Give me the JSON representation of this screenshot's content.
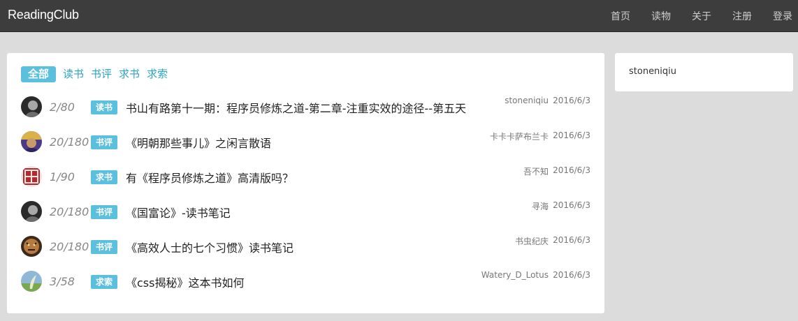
{
  "navbar": {
    "brand": "ReadingClub",
    "links": [
      "首页",
      "读物",
      "关于",
      "注册",
      "登录"
    ]
  },
  "tabs": [
    "全部",
    "读书",
    "书评",
    "求书",
    "求索"
  ],
  "topics": [
    {
      "count": "2/80",
      "badge": "读书",
      "title": "书山有路第十一期：程序员修炼之道-第二章-注重实效的途径--第五天",
      "author": "stoneniqiu",
      "date": "2016/6/3"
    },
    {
      "count": "20/180",
      "badge": "书评",
      "title": "《明朝那些事儿》之闲言散语",
      "author": "卡卡卡萨布兰卡",
      "date": "2016/6/3"
    },
    {
      "count": "1/90",
      "badge": "求书",
      "title": "有《程序员修炼之道》高清版吗？",
      "author": "吾不知",
      "date": "2016/6/3"
    },
    {
      "count": "20/180",
      "badge": "书评",
      "title": "《国富论》-读书笔记",
      "author": "寻海",
      "date": "2016/6/3"
    },
    {
      "count": "20/180",
      "badge": "书评",
      "title": "《高效人士的七个习惯》读书笔记",
      "author": "书虫纪庆",
      "date": "2016/6/3"
    },
    {
      "count": "3/58",
      "badge": "求索",
      "title": "《css揭秘》这本书如何",
      "author": "Watery_D_Lotus",
      "date": "2016/6/3"
    }
  ],
  "sidebar": {
    "username": "stoneniqiu"
  },
  "colors": {
    "navbar": "#3d3d3d",
    "accent": "#5bc0de",
    "link": "#2aa6c6",
    "background": "#dcdcdc"
  }
}
